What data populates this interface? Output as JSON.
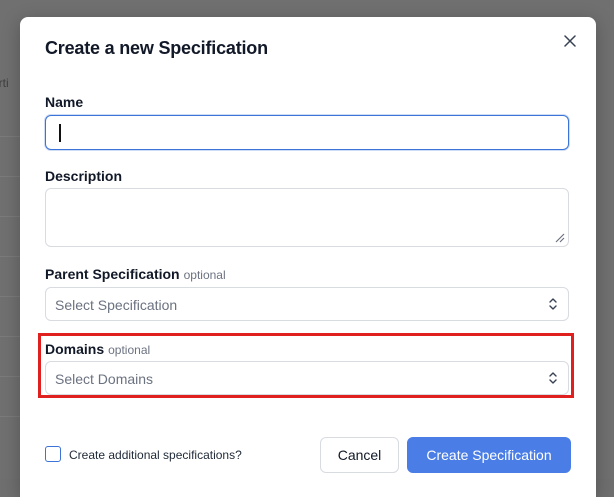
{
  "modal": {
    "title": "Create a new Specification",
    "close_icon": "close-icon"
  },
  "background": {
    "partial_text": "erti"
  },
  "form": {
    "name": {
      "label": "Name",
      "value": ""
    },
    "description": {
      "label": "Description",
      "value": ""
    },
    "parent_specification": {
      "label": "Parent Specification",
      "optional": "optional",
      "placeholder": "Select Specification"
    },
    "domains": {
      "label": "Domains",
      "optional": "optional",
      "placeholder": "Select Domains"
    }
  },
  "footer": {
    "checkbox_label": "Create additional specifications?",
    "checkbox_checked": false,
    "cancel_label": "Cancel",
    "create_label": "Create Specification"
  },
  "colors": {
    "primary": "#4a7ee6",
    "highlight": "#e0201f",
    "focus_border": "#3b73d8"
  }
}
